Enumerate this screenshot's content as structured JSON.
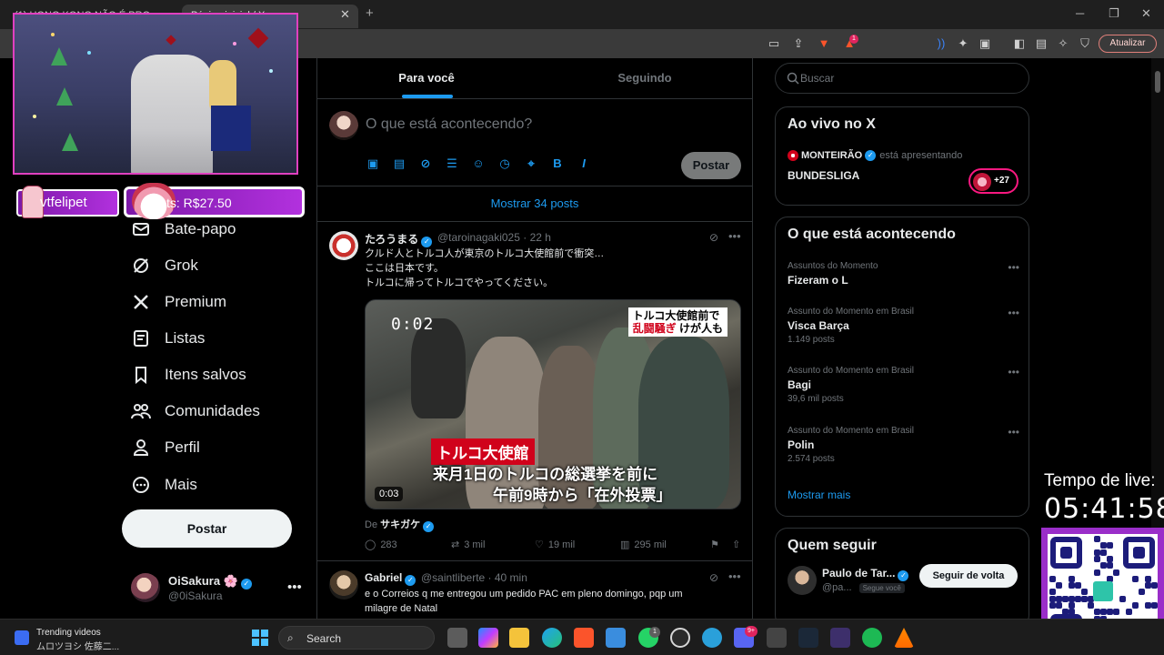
{
  "browser": {
    "tab_active_title": "(1) HONG KONG NÃO É PRO...",
    "tab2_title": "Página inicial / X",
    "update_label": "Atualizar",
    "shields_badge": "1"
  },
  "nav": {
    "items": [
      {
        "label": "Bate-papo",
        "icon": "chat-icon"
      },
      {
        "label": "Grok",
        "icon": "grok-icon"
      },
      {
        "label": "Premium",
        "icon": "x-logo-icon"
      },
      {
        "label": "Listas",
        "icon": "list-icon"
      },
      {
        "label": "Itens salvos",
        "icon": "bookmark-icon"
      },
      {
        "label": "Comunidades",
        "icon": "communities-icon"
      },
      {
        "label": "Perfil",
        "icon": "profile-icon"
      },
      {
        "label": "Mais",
        "icon": "more-circle-icon"
      }
    ],
    "post_label": "Postar",
    "account": {
      "name": "OiSakura 🌸",
      "handle": "@0iSakura"
    }
  },
  "feed": {
    "tabs": [
      "Para você",
      "Seguindo"
    ],
    "compose_placeholder": "O que está acontecendo?",
    "compose_post": "Postar",
    "show_posts": "Mostrar 34 posts",
    "tweet1": {
      "name": "たろうまる",
      "handle": "@taroinagaki025 · 22 h",
      "line1": "クルド人とトルコ人が東京のトルコ大使館前で衝突…",
      "line2": "ここは日本です。",
      "line3": "トルコに帰ってトルコでやってください。",
      "media": {
        "timestamp": "0:02",
        "caption_top_1": "トルコ大使館前で",
        "caption_top_2a": "乱闘騒ぎ",
        "caption_top_2b": "けが人も",
        "caption_tag": "トルコ大使館",
        "caption_line1": "来月1日のトルコの総選挙を前に",
        "caption_line2": "午前9時から「在外投票」",
        "duration": "0:03"
      },
      "from_prefix": "De",
      "from_name": "サキガケ",
      "replies": "283",
      "reposts": "3 mil",
      "likes": "19 mil",
      "views": "295 mil"
    },
    "tweet2": {
      "name": "Gabriel",
      "handle": "@saintliberte · 40 min",
      "line1": "e o Correios q me entregou um pedido PAC em pleno domingo, pqp um",
      "line2": "milagre de Natal"
    }
  },
  "right": {
    "search_placeholder": "Buscar",
    "live": {
      "title": "Ao vivo no X",
      "host": "MONTEIRÃO",
      "host_suffix": "está apresentando",
      "event": "BUNDESLIGA",
      "count": "+27"
    },
    "trends": {
      "title": "O que está acontecendo",
      "items": [
        {
          "context": "Assuntos do Momento",
          "name": "Fizeram o L",
          "count": ""
        },
        {
          "context": "Assunto do Momento em Brasil",
          "name": "Visca Barça",
          "count": "1.149 posts"
        },
        {
          "context": "Assunto do Momento em Brasil",
          "name": "Bagi",
          "count": "39,6 mil posts"
        },
        {
          "context": "Assunto do Momento em Brasil",
          "name": "Polin",
          "count": "2.574 posts"
        }
      ],
      "show_more": "Mostrar mais"
    },
    "follow": {
      "title": "Quem seguir",
      "name": "Paulo de Tar...",
      "handle": "@pa...",
      "follows_you": "Segue você",
      "button": "Seguir de volta"
    }
  },
  "stream": {
    "username": "vtfelipet",
    "points": "ts: R$27.50",
    "timer_label": "Tempo de live:",
    "timer": "05:41:58"
  },
  "taskbar": {
    "widget_title": "Trending videos",
    "widget_sub": "ムロツヨシ 佐藤二...",
    "search": "Search",
    "whatsapp_badge": "1",
    "discord_badge": "9+"
  },
  "colors": {
    "x_blue": "#1d9bf0",
    "live_pink": "#f91880",
    "overlay_purple": "#b231de"
  }
}
